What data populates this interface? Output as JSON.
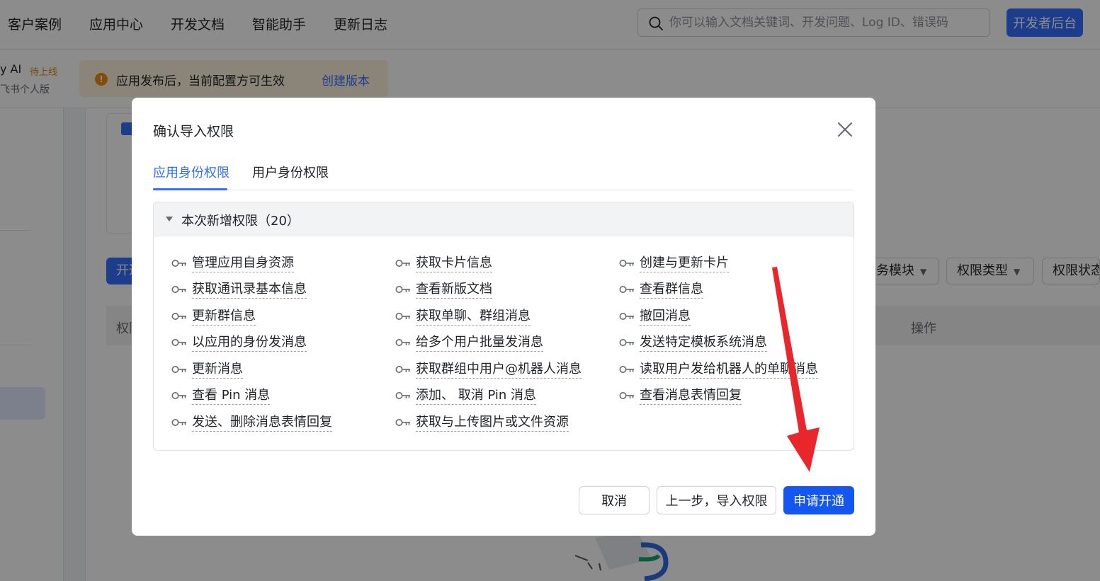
{
  "nav": {
    "items": [
      "客户案例",
      "应用中心",
      "开发文档",
      "智能助手",
      "更新日志"
    ],
    "search_placeholder": "你可以输入文档关键词、开发问题、Log ID、错误码",
    "dev_console_label": "开发者后台"
  },
  "app": {
    "name": "y AI",
    "status": "待上线",
    "subtitle": "飞书个人版"
  },
  "notice": {
    "text": "应用发布后，当前配置方可生效",
    "link": "创建版本"
  },
  "background": {
    "open_button_partial": "开通",
    "filters": [
      "务模块",
      "权限类型",
      "权限状态"
    ],
    "table_headers": {
      "permission": "权限",
      "operation": "操作"
    }
  },
  "modal": {
    "title": "确认导入权限",
    "tabs": [
      {
        "label": "应用身份权限",
        "active": true
      },
      {
        "label": "用户身份权限",
        "active": false
      }
    ],
    "section_title": "本次新增权限（20）",
    "permissions": [
      "管理应用自身资源",
      "获取卡片信息",
      "创建与更新卡片",
      "获取通讯录基本信息",
      "查看新版文档",
      "查看群信息",
      "更新群信息",
      "获取单聊、群组消息",
      "撤回消息",
      "以应用的身份发消息",
      "给多个用户批量发消息",
      "发送特定模板系统消息",
      "更新消息",
      "获取群组中用户@机器人消息",
      "读取用户发给机器人的单聊消息",
      "查看 Pin 消息",
      "添加、 取消 Pin 消息",
      "查看消息表情回复",
      "发送、删除消息表情回复",
      "获取与上传图片或文件资源"
    ],
    "buttons": {
      "cancel": "取消",
      "back": "上一步，导入权限",
      "apply": "申请开通"
    }
  },
  "colors": {
    "primary": "#3370ff",
    "apply_button": "#1456f0",
    "annotation_arrow": "#e8262b",
    "warning": "#f08a13"
  },
  "icons": [
    "search-icon",
    "warning-icon",
    "close-icon",
    "caret-down-icon",
    "key-icon",
    "chevron-down-icon"
  ]
}
